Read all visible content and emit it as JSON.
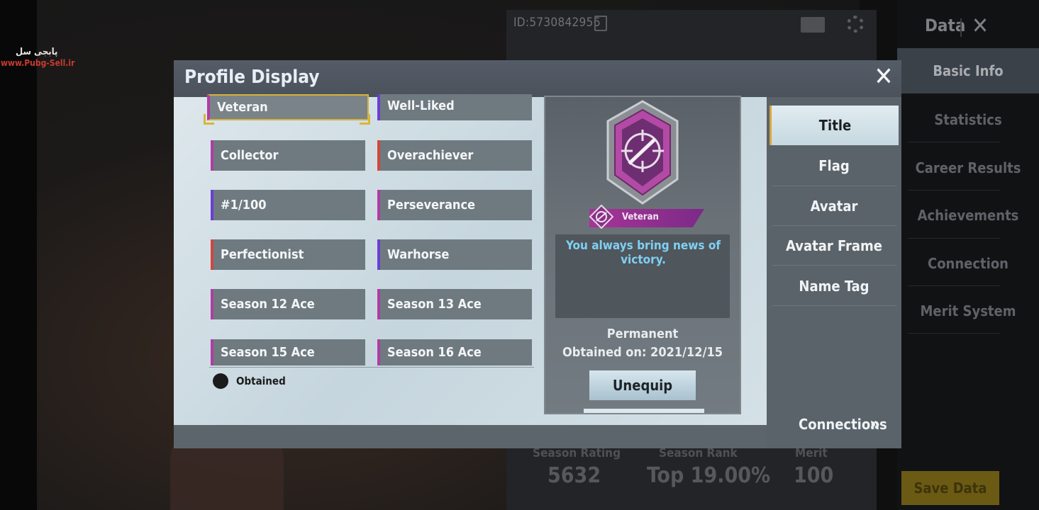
{
  "background": {
    "player_id": "ID:5730842956",
    "nav_header": "Data",
    "nav_items": [
      "Basic Info",
      "Statistics",
      "Career Results",
      "Achievements",
      "Connection",
      "Merit System"
    ],
    "active_nav": "Basic Info",
    "stats": [
      {
        "label": "Season Rating",
        "value": "5632"
      },
      {
        "label": "Season Rank",
        "value": "Top 19.00%"
      },
      {
        "label": "Merit",
        "value": "100"
      }
    ],
    "save_button": "Save Data"
  },
  "watermark": {
    "line1": "پابجی سل",
    "line2": "www.Pubg-Sell.ir"
  },
  "modal": {
    "title": "Profile Display",
    "titles": [
      {
        "label": "Veteran",
        "accent": "magenta",
        "selected": true
      },
      {
        "label": "Well-Liked",
        "accent": "purple",
        "selected": false
      },
      {
        "label": "Collector",
        "accent": "magenta",
        "selected": false
      },
      {
        "label": "Overachiever",
        "accent": "red",
        "selected": false
      },
      {
        "label": "#1/100",
        "accent": "purple",
        "selected": false
      },
      {
        "label": "Perseverance",
        "accent": "magenta",
        "selected": false
      },
      {
        "label": "Perfectionist",
        "accent": "red",
        "selected": false
      },
      {
        "label": "Warhorse",
        "accent": "purple",
        "selected": false
      },
      {
        "label": "Season 12 Ace",
        "accent": "magenta",
        "selected": false
      },
      {
        "label": "Season 13 Ace",
        "accent": "magenta",
        "selected": false
      },
      {
        "label": "Season 15 Ace",
        "accent": "magenta",
        "selected": false
      },
      {
        "label": "Season 16 Ace",
        "accent": "magenta",
        "selected": false
      }
    ],
    "legend": {
      "obtained": "Obtained"
    },
    "detail": {
      "badge_icon": "crosshair-rifle-icon",
      "name": "Veteran",
      "description": "You always bring news of victory.",
      "duration": "Permanent",
      "obtained_on": "Obtained on: 2021/12/15",
      "action_button": "Unequip"
    },
    "tabs": [
      "Title",
      "Flag",
      "Avatar",
      "Avatar Frame",
      "Name Tag"
    ],
    "active_tab": "Title",
    "connections_label": "Connections"
  },
  "colors": {
    "accent_magenta": "#b03ca4",
    "accent_purple": "#6a3fd2",
    "accent_red": "#d0473d",
    "selected_border": "#d6b23a",
    "description_text": "#7fd0f3"
  }
}
